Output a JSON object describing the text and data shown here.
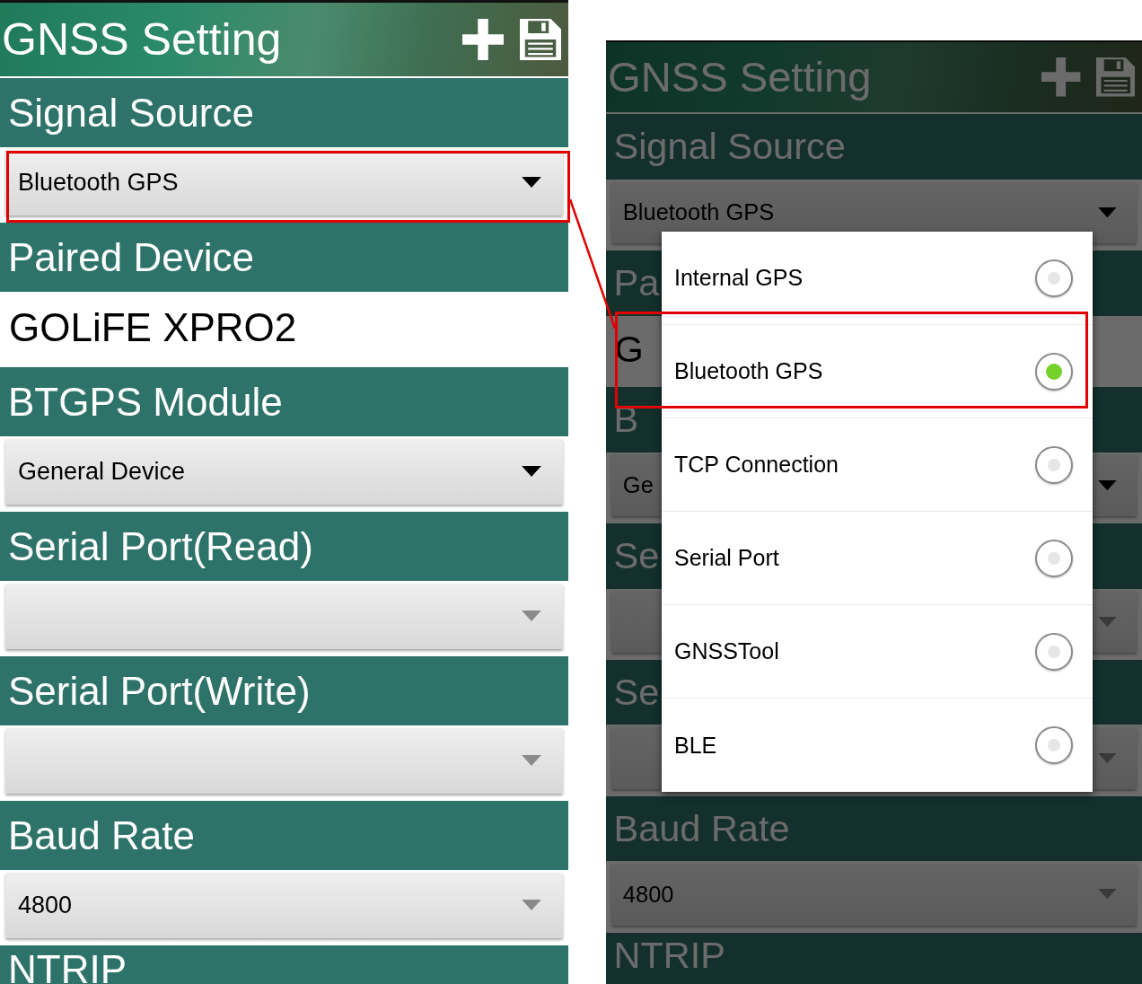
{
  "screens": [
    {
      "dimmed": false,
      "header": {
        "title": "GNSS Setting"
      },
      "sections": [
        {
          "label": "Signal Source",
          "field": {
            "kind": "dropdown",
            "value": "Bluetooth GPS",
            "disabled": false
          }
        },
        {
          "label": "Paired Device",
          "field": {
            "kind": "text",
            "value": "GOLiFE XPRO2"
          }
        },
        {
          "label": "BTGPS Module",
          "field": {
            "kind": "dropdown",
            "value": "General Device",
            "disabled": false
          }
        },
        {
          "label": "Serial Port(Read)",
          "field": {
            "kind": "dropdown",
            "disabled": true
          }
        },
        {
          "label": "Serial Port(Write)",
          "field": {
            "kind": "dropdown",
            "disabled": true
          }
        },
        {
          "label": "Baud Rate",
          "field": {
            "kind": "dropdown",
            "value": "4800",
            "disabled": true
          }
        },
        {
          "label": "NTRIP"
        }
      ]
    },
    {
      "dimmed": true,
      "header": {
        "title": "GNSS Setting"
      },
      "sections": [
        {
          "label": "Signal Source",
          "field": {
            "kind": "dropdown",
            "value": "Bluetooth GPS",
            "disabled": false
          }
        },
        {
          "label": "Pa",
          "field": {
            "kind": "text",
            "value": "G"
          }
        },
        {
          "label": "B",
          "field": {
            "kind": "dropdown",
            "value": "Ge",
            "disabled": false
          }
        },
        {
          "label": "Se",
          "field": {
            "kind": "dropdown",
            "disabled": true
          }
        },
        {
          "label": "Se",
          "field": {
            "kind": "dropdown",
            "disabled": true
          }
        },
        {
          "label": "Baud Rate",
          "field": {
            "kind": "dropdown",
            "value": "4800",
            "disabled": true
          }
        },
        {
          "label": "NTRIP"
        }
      ],
      "dialog": {
        "options": [
          {
            "label": "Internal GPS",
            "selected": false
          },
          {
            "label": "Bluetooth GPS",
            "selected": true
          },
          {
            "label": "TCP Connection",
            "selected": false
          },
          {
            "label": "Serial Port",
            "selected": false
          },
          {
            "label": "GNSSTool",
            "selected": false
          },
          {
            "label": "BLE",
            "selected": false
          }
        ]
      }
    }
  ]
}
